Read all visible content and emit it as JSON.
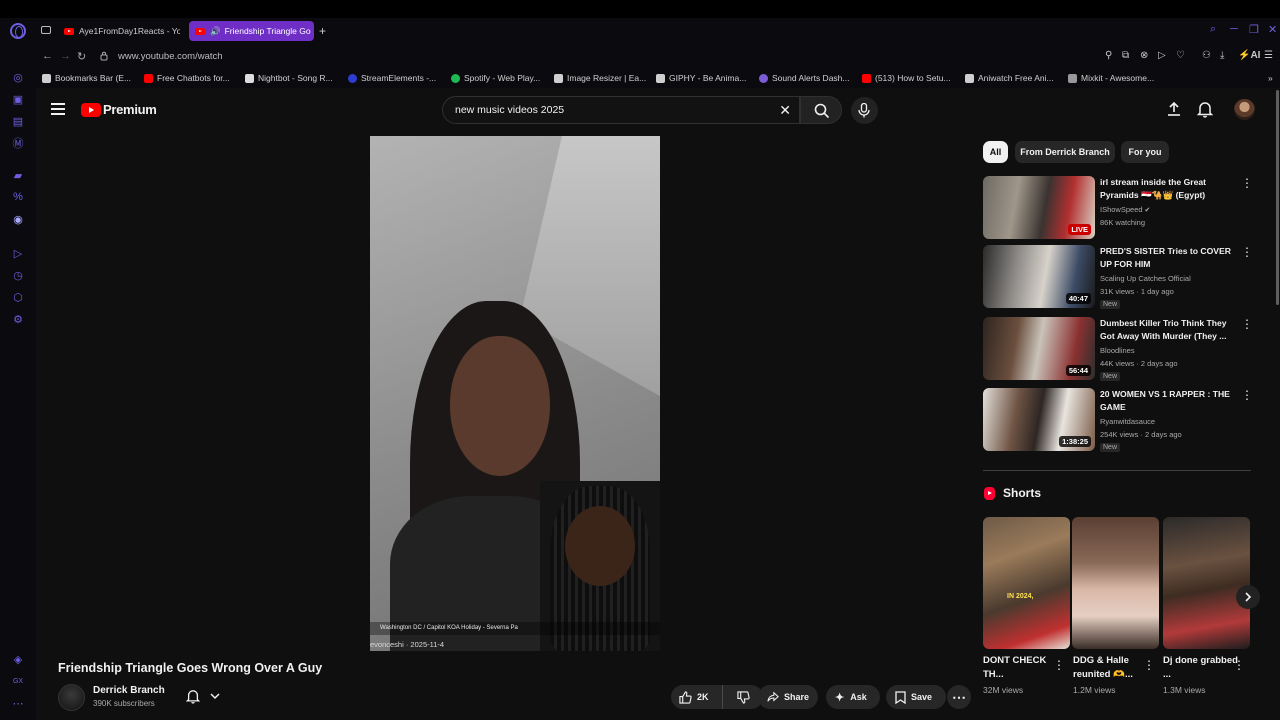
{
  "browser": {
    "tabs": [
      {
        "label": "Aye1FromDay1Reacts - Yo"
      },
      {
        "label": "Friendship Triangle Go"
      }
    ],
    "new_tab_glyph": "+",
    "url": "www.youtube.com/watch",
    "ai_label": "AI",
    "bookmarks": [
      {
        "label": "Bookmarks Bar (E...",
        "icon": "folder-icon",
        "color": "#cfcfcf"
      },
      {
        "label": "Free Chatbots for...",
        "icon": "youtube-icon",
        "color": "#ff0000"
      },
      {
        "label": "Nightbot - Song R...",
        "icon": "nightbot-icon",
        "color": "#dddddd"
      },
      {
        "label": "StreamElements -...",
        "icon": "streamelements-icon",
        "color": "#2d3dcf"
      },
      {
        "label": "Spotify - Web Play...",
        "icon": "spotify-icon",
        "color": "#1db954"
      },
      {
        "label": "Image Resizer | Ea...",
        "icon": "image-resizer-icon",
        "color": "#cfcfcf"
      },
      {
        "label": "GIPHY - Be Anima...",
        "icon": "giphy-icon",
        "color": "#cfcfcf"
      },
      {
        "label": "Sound Alerts Dash...",
        "icon": "sound-alerts-icon",
        "color": "#7b5cd6"
      },
      {
        "label": "(513) How to Setu...",
        "icon": "youtube-icon",
        "color": "#ff0000"
      },
      {
        "label": "Aniwatch Free Ani...",
        "icon": "aniwatch-icon",
        "color": "#cfcfcf"
      },
      {
        "label": "Mixkit - Awesome...",
        "icon": "mixkit-icon",
        "color": "#999999"
      }
    ]
  },
  "youtube": {
    "logo_text": "Premium",
    "search": {
      "value": "new music videos 2025"
    },
    "video": {
      "caption": "Washington DC / Capitol KOA Holiday - Severna Pa",
      "credit": "evonceshi · 2025-11-4",
      "title": "Friendship Triangle Goes Wrong Over A Guy",
      "channel": "Derrick Branch",
      "subscribers": "390K subscribers",
      "likes": "2K",
      "share_label": "Share",
      "ask_label": "Ask",
      "save_label": "Save"
    },
    "chips": [
      {
        "label": "All",
        "active": true
      },
      {
        "label": "From Derrick Branch",
        "active": false
      },
      {
        "label": "For you",
        "active": false
      }
    ],
    "recommendations": [
      {
        "title": "irl stream inside the Great Pyramids 🇪🇬🐪👑 (Egypt)",
        "channel": "IShowSpeed",
        "verified": true,
        "stats": "86K watching",
        "badge": "LIVE",
        "new": ""
      },
      {
        "title": "PRED'S SISTER Tries to COVER UP FOR HIM",
        "channel": "Scaling Up Catches Official",
        "stats": "31K views · 1 day ago",
        "badge": "40:47",
        "new": "New"
      },
      {
        "title": "Dumbest Killer Trio Think They Got Away With Murder (They ...",
        "channel": "Bloodlines",
        "stats": "44K views · 2 days ago",
        "badge": "56:44",
        "new": "New"
      },
      {
        "title": "20 WOMEN VS 1 RAPPER : THE GAME",
        "channel": "Ryanwitdasauce",
        "stats": "254K views · 2 days ago",
        "badge": "1:38:25",
        "new": "New"
      }
    ],
    "shorts": {
      "header": "Shorts",
      "items": [
        {
          "title": "DONT CHECK TH...",
          "views": "32M views"
        },
        {
          "title": "DDG & Halle reunited 🫶...",
          "views": "1.2M views"
        },
        {
          "title": "Dj done grabbed ...",
          "views": "1.3M views"
        }
      ]
    }
  },
  "colors": {
    "opera_accent": "#6d5fe0",
    "active_tab": "#6f2fc7",
    "youtube_red": "#ff0000",
    "page_bg": "#0f0f0f"
  }
}
